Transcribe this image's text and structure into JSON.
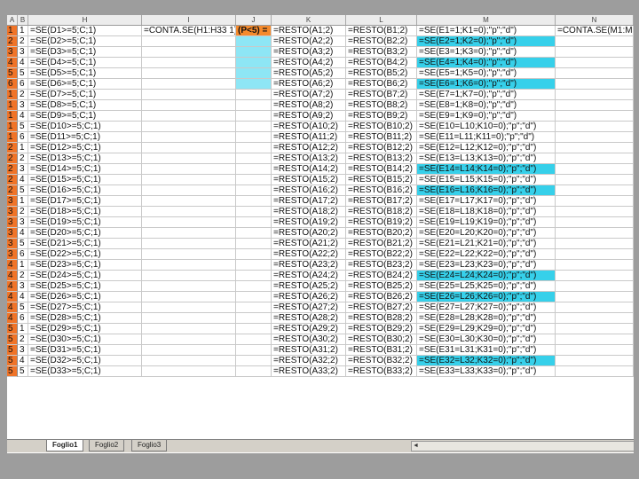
{
  "columns": [
    "A",
    "B",
    "H",
    "I",
    "J",
    "K",
    "L",
    "M",
    "N"
  ],
  "header_formulas": {
    "I": "=CONTA.SE(H1:H33 1)",
    "J": "(P<5) =",
    "N": "=CONTA.SE(M1:M33"
  },
  "rows": [
    [
      "1",
      "1",
      "=SE(D1>=5;C;1)",
      "=RESTO(A1;2)",
      "=RESTO(B1;2)",
      "=SE(E1=1;K1=0);\"p\";\"d\")"
    ],
    [
      "2",
      "2",
      "=SE(D2>=5;C;1)",
      "=RESTO(A2;2)",
      "=RESTO(B2;2)",
      "=SE(E2=1;K2=0);\"p\";\"d\")"
    ],
    [
      "3",
      "3",
      "=SE(D3>=5;C;1)",
      "=RESTO(A3;2)",
      "=RESTO(B3;2)",
      "=SE(E3=1;K3=0);\"p\";\"d\")"
    ],
    [
      "4",
      "4",
      "=SE(D4>=5;C;1)",
      "=RESTO(A4;2)",
      "=RESTO(B4;2)",
      "=SE(E4=1;K4=0);\"p\";\"d\")"
    ],
    [
      "5",
      "5",
      "=SE(D5>=5;C;1)",
      "=RESTO(A5;2)",
      "=RESTO(B5;2)",
      "=SE(E5=1;K5=0);\"p\";\"d\")"
    ],
    [
      "6",
      "6",
      "=SE(D6>=5;C;1)",
      "=RESTO(A6;2)",
      "=RESTO(B6;2)",
      "=SE(E6=1;K6=0);\"p\";\"d\")"
    ],
    [
      "1",
      "2",
      "=SE(D7>=5;C;1)",
      "=RESTO(A7;2)",
      "=RESTO(B7;2)",
      "=SE(E7=1;K7=0);\"p\";\"d\")"
    ],
    [
      "1",
      "3",
      "=SE(D8>=5;C;1)",
      "=RESTO(A8;2)",
      "=RESTO(B8;2)",
      "=SE(E8=1;K8=0);\"p\";\"d\")"
    ],
    [
      "1",
      "4",
      "=SE(D9>=5;C;1)",
      "=RESTO(A9;2)",
      "=RESTO(B9;2)",
      "=SE(E9=1;K9=0);\"p\";\"d\")"
    ],
    [
      "1",
      "5",
      "=SE(D10>=5;C;1)",
      "=RESTO(A10;2)",
      "=RESTO(B10;2)",
      "=SE(E10=L10;K10=0);\"p\";\"d\")"
    ],
    [
      "1",
      "6",
      "=SE(D11>=5;C;1)",
      "=RESTO(A11;2)",
      "=RESTO(B11;2)",
      "=SE(E11=L11;K11=0);\"p\";\"d\")"
    ],
    [
      "2",
      "1",
      "=SE(D12>=5;C;1)",
      "=RESTO(A12;2)",
      "=RESTO(B12;2)",
      "=SE(E12=L12;K12=0);\"p\";\"d\")"
    ],
    [
      "2",
      "2",
      "=SE(D13>=5;C;1)",
      "=RESTO(A13;2)",
      "=RESTO(B13;2)",
      "=SE(E13=L13;K13=0);\"p\";\"d\")"
    ],
    [
      "2",
      "3",
      "=SE(D14>=5;C;1)",
      "=RESTO(A14;2)",
      "=RESTO(B14;2)",
      "=SE(E14=L14;K14=0);\"p\";\"d\")"
    ],
    [
      "2",
      "4",
      "=SE(D15>=5;C;1)",
      "=RESTO(A15;2)",
      "=RESTO(B15;2)",
      "=SE(E15=L15;K15=0);\"p\";\"d\")"
    ],
    [
      "2",
      "5",
      "=SE(D16>=5;C;1)",
      "=RESTO(A16;2)",
      "=RESTO(B16;2)",
      "=SE(E16=L16;K16=0);\"p\";\"d\")"
    ],
    [
      "3",
      "1",
      "=SE(D17>=5;C;1)",
      "=RESTO(A17;2)",
      "=RESTO(B17;2)",
      "=SE(E17=L17;K17=0);\"p\";\"d\")"
    ],
    [
      "3",
      "2",
      "=SE(D18>=5;C;1)",
      "=RESTO(A18;2)",
      "=RESTO(B18;2)",
      "=SE(E18=L18;K18=0);\"p\";\"d\")"
    ],
    [
      "3",
      "3",
      "=SE(D19>=5;C;1)",
      "=RESTO(A19;2)",
      "=RESTO(B19;2)",
      "=SE(E19=L19;K19=0);\"p\";\"d\")"
    ],
    [
      "3",
      "4",
      "=SE(D20>=5;C;1)",
      "=RESTO(A20;2)",
      "=RESTO(B20;2)",
      "=SE(E20=L20;K20=0);\"p\";\"d\")"
    ],
    [
      "3",
      "5",
      "=SE(D21>=5;C;1)",
      "=RESTO(A21;2)",
      "=RESTO(B21;2)",
      "=SE(E21=L21;K21=0);\"p\";\"d\")"
    ],
    [
      "3",
      "6",
      "=SE(D22>=5;C;1)",
      "=RESTO(A22;2)",
      "=RESTO(B22;2)",
      "=SE(E22=L22;K22=0);\"p\";\"d\")"
    ],
    [
      "4",
      "1",
      "=SE(D23>=5;C;1)",
      "=RESTO(A23;2)",
      "=RESTO(B23;2)",
      "=SE(E23=L23;K23=0);\"p\";\"d\")"
    ],
    [
      "4",
      "2",
      "=SE(D24>=5;C;1)",
      "=RESTO(A24;2)",
      "=RESTO(B24;2)",
      "=SE(E24=L24;K24=0);\"p\";\"d\")"
    ],
    [
      "4",
      "3",
      "=SE(D25>=5;C;1)",
      "=RESTO(A25;2)",
      "=RESTO(B25;2)",
      "=SE(E25=L25;K25=0);\"p\";\"d\")"
    ],
    [
      "4",
      "4",
      "=SE(D26>=5;C;1)",
      "=RESTO(A26;2)",
      "=RESTO(B26;2)",
      "=SE(E26=L26;K26=0);\"p\";\"d\")"
    ],
    [
      "4",
      "5",
      "=SE(D27>=5;C;1)",
      "=RESTO(A27;2)",
      "=RESTO(B27;2)",
      "=SE(E27=L27;K27=0);\"p\";\"d\")"
    ],
    [
      "4",
      "6",
      "=SE(D28>=5;C;1)",
      "=RESTO(A28;2)",
      "=RESTO(B28;2)",
      "=SE(E28=L28;K28=0);\"p\";\"d\")"
    ],
    [
      "5",
      "1",
      "=SE(D29>=5;C;1)",
      "=RESTO(A29;2)",
      "=RESTO(B29;2)",
      "=SE(E29=L29;K29=0);\"p\";\"d\")"
    ],
    [
      "5",
      "2",
      "=SE(D30>=5;C;1)",
      "=RESTO(A30;2)",
      "=RESTO(B30;2)",
      "=SE(E30=L30;K30=0);\"p\";\"d\")"
    ],
    [
      "5",
      "3",
      "=SE(D31>=5;C;1)",
      "=RESTO(A31;2)",
      "=RESTO(B31;2)",
      "=SE(E31=L31;K31=0);\"p\";\"d\")"
    ],
    [
      "5",
      "4",
      "=SE(D32>=5;C;1)",
      "=RESTO(A32;2)",
      "=RESTO(B32;2)",
      "=SE(E32=L32;K32=0);\"p\";\"d\")"
    ],
    [
      "5",
      "5",
      "=SE(D33>=5;C;1)",
      "=RESTO(A33;2)",
      "=RESTO(B33;2)",
      "=SE(E33=L33;K33=0);\"p\";\"d\")"
    ]
  ],
  "highlight_m_rows": [
    1,
    3,
    5,
    13,
    15,
    23,
    25,
    31
  ],
  "sheet_tabs": [
    "Foglio1",
    "Foglio2",
    "Foglio3"
  ],
  "colors": {
    "orange": "#f58a2c",
    "cyan": "#36d0ea",
    "light_cyan": "#8ee6f5",
    "rowhead": "#f07428"
  }
}
